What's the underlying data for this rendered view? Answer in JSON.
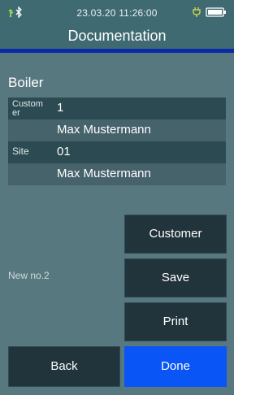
{
  "status": {
    "datetime": "23.03.20 11:26:00",
    "icons": [
      "usb-icon",
      "bluetooth-icon",
      "plug-icon",
      "battery-icon"
    ]
  },
  "header": {
    "title": "Documentation"
  },
  "section": {
    "title": "Boiler"
  },
  "fields": {
    "customer_label": "Custom er",
    "customer_number": "1",
    "customer_name": "Max Mustermann",
    "site_label": "Site",
    "site_number": "01",
    "site_name": "Max Mustermann"
  },
  "new_number": "New no.2",
  "buttons": {
    "customer": "Customer",
    "save": "Save",
    "print": "Print",
    "back": "Back",
    "done": "Done"
  },
  "colors": {
    "background": "#58787f",
    "header": "#3f6a72",
    "accent_line": "#0b2aa8",
    "button": "#21343b",
    "primary_button": "#0a55f6"
  }
}
